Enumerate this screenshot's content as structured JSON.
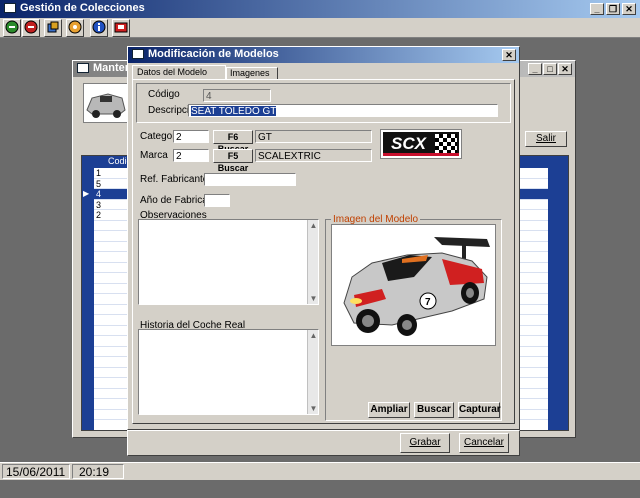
{
  "app": {
    "title": "Gestión de Colecciones"
  },
  "toolbar": {
    "icons": [
      "exit-icon",
      "stop-icon",
      "cube-icon",
      "calendar-icon",
      "info-icon",
      "printer-icon"
    ]
  },
  "background_window": {
    "title": "Mantenimi",
    "salir_label": "Salir",
    "grid_header": "Codigo",
    "rows": [
      "1",
      "5",
      "4",
      "3",
      "2"
    ],
    "selected_row": 2
  },
  "dialog": {
    "title": "Modificación de Modelos",
    "tabs": [
      "Datos del Modelo",
      "Imagenes"
    ],
    "codigo_label": "Código",
    "codigo_value": "4",
    "descripcion_label": "Descripción",
    "descripcion_value": "SEAT TOLEDO GT",
    "categoria_label": "Categoria",
    "categoria_code": "2",
    "categoria_btn": "F6 Buscar",
    "categoria_name": "GT",
    "marca_label": "Marca",
    "marca_code": "2",
    "marca_btn": "F5 Buscar",
    "marca_name": "SCALEXTRIC",
    "brand_logo_text": "SCX",
    "ref_label": "Ref. Fabricante",
    "ref_value": "",
    "anio_label": "Año de Fabricación",
    "anio_value": "",
    "observaciones_label": "Observaciones",
    "historia_label": "Historia del Coche Real",
    "imagen_label": "Imagen del Modelo",
    "ampliar_btn": "Ampliar",
    "buscar_btn": "Buscar",
    "capturar_btn": "Capturar",
    "grabar_btn": "Grabar",
    "cancelar_btn": "Cancelar",
    "car_number": "7"
  },
  "statusbar": {
    "date": "15/06/2011",
    "time": "20:19"
  },
  "colors": {
    "accent_blue": "#0a246a",
    "grid_blue": "#1c3f94",
    "logo_red": "#c8102e"
  }
}
